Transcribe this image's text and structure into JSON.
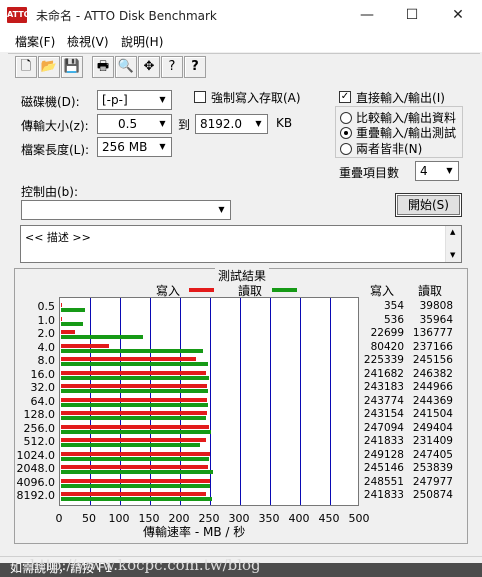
{
  "window": {
    "icon_label": "ATTO",
    "title": "未命名 - ATTO Disk Benchmark",
    "minimize": "—",
    "maximize": "☐",
    "close": "✕"
  },
  "menu": [
    "檔案(F)",
    "檢視(V)",
    "說明(H)"
  ],
  "toolbar": [
    "new-icon",
    "open-icon",
    "save-icon",
    "print-icon",
    "print-preview-icon",
    "move-icon",
    "help-icon",
    "context-help-icon"
  ],
  "toolbar_glyphs": [
    "🗋",
    "📂",
    "💾",
    "🖶",
    "🔍",
    "✥",
    "?",
    "?"
  ],
  "controls": {
    "drive_label": "磁碟機(D):",
    "drive_value": "[-p-]",
    "transfer_label": "傳輸大小(z):",
    "transfer_from": "0.5",
    "transfer_to_label": "到",
    "transfer_to": "8192.0",
    "transfer_unit": "KB",
    "file_length_label": "檔案長度(L):",
    "file_length": "256 MB",
    "force_write_label": "強制寫入存取(A)",
    "force_write_checked": false,
    "direct_io_label": "直接輸入/輸出(I)",
    "direct_io_checked": true,
    "compare_io_label": "比較輸入/輸出資料",
    "overlap_io_label": "重疊輸入/輸出測試",
    "neither_label": "兩者皆非(N)",
    "selected_mode": "overlap",
    "queue_depth_label": "重疊項目數",
    "queue_depth": "4",
    "controlled_by_label": "控制由(b):",
    "controlled_by_value": "",
    "start_button": "開始(S)",
    "description": "<< 描述 >>"
  },
  "results": {
    "title": "測試結果",
    "write_legend": "寫入",
    "read_legend": "讀取",
    "write_col": "寫入",
    "read_col": "讀取",
    "xlabel": "傳輸速率 - MB / 秒"
  },
  "chart_data": {
    "type": "bar",
    "orientation": "horizontal",
    "categories": [
      "0.5",
      "1.0",
      "2.0",
      "4.0",
      "8.0",
      "16.0",
      "32.0",
      "64.0",
      "128.0",
      "256.0",
      "512.0",
      "1024.0",
      "2048.0",
      "4096.0",
      "8192.0"
    ],
    "series": [
      {
        "name": "寫入",
        "color": "#e31b1b",
        "values": [
          354,
          536,
          22699,
          80420,
          225339,
          241682,
          243183,
          243774,
          243154,
          247094,
          241833,
          249128,
          245146,
          248551,
          241833
        ]
      },
      {
        "name": "讀取",
        "color": "#169a16",
        "values": [
          39808,
          35964,
          136777,
          237166,
          245156,
          246382,
          244966,
          244369,
          241504,
          249404,
          231409,
          247405,
          253839,
          247977,
          250874
        ]
      }
    ],
    "value_unit_divisor": 1000,
    "xlabel": "傳輸速率 - MB / 秒",
    "xlim": [
      0,
      500
    ],
    "xticks": [
      0,
      50,
      100,
      150,
      200,
      250,
      300,
      350,
      400,
      450,
      500
    ],
    "grid": true
  },
  "status": {
    "text": "如需說明，請按 F1",
    "watermark": "http://www.kocpc.com.tw/blog"
  }
}
